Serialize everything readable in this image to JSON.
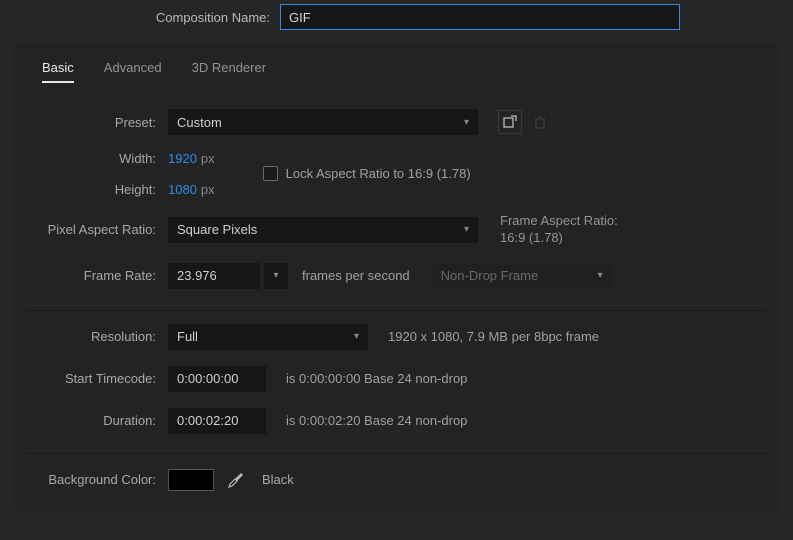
{
  "compNameLabel": "Composition Name:",
  "compName": "GIF",
  "tabs": {
    "basic": "Basic",
    "advanced": "Advanced",
    "renderer": "3D Renderer"
  },
  "preset": {
    "label": "Preset:",
    "value": "Custom"
  },
  "width": {
    "label": "Width:",
    "value": "1920",
    "unit": "px"
  },
  "height": {
    "label": "Height:",
    "value": "1080",
    "unit": "px"
  },
  "lockAspect": {
    "label": "Lock Aspect Ratio to 16:9 (1.78)"
  },
  "pixelAspect": {
    "label": "Pixel Aspect Ratio:",
    "value": "Square Pixels"
  },
  "frameAspect": {
    "label": "Frame Aspect Ratio:",
    "value": "16:9 (1.78)"
  },
  "frameRate": {
    "label": "Frame Rate:",
    "value": "23.976",
    "fpsLabel": "frames per second",
    "dropMode": "Non-Drop Frame"
  },
  "resolution": {
    "label": "Resolution:",
    "value": "Full",
    "info": "1920 x 1080, 7.9 MB per 8bpc frame"
  },
  "startTimecode": {
    "label": "Start Timecode:",
    "value": "0:00:00:00",
    "info": "is 0:00:00:00  Base 24  non-drop"
  },
  "duration": {
    "label": "Duration:",
    "value": "0:00:02:20",
    "info": "is 0:00:02:20  Base 24  non-drop"
  },
  "bgColor": {
    "label": "Background Color:",
    "name": "Black",
    "hex": "#000000"
  }
}
